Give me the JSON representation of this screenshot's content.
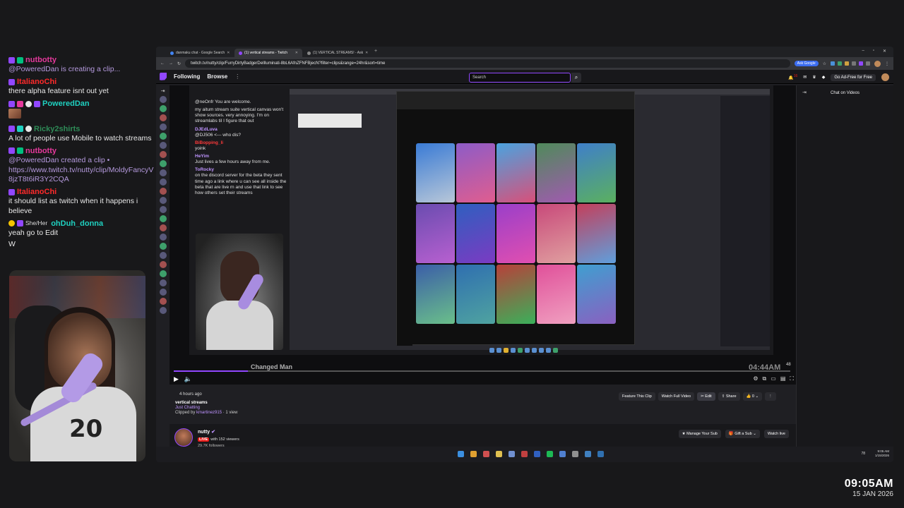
{
  "overlay_chat": [
    {
      "user": "nutbotty",
      "color": "#e5399c",
      "badges": [
        "b-purple",
        "b-green"
      ],
      "text": "@PoweredDan is creating a clip...",
      "text_color": "#b59ade"
    },
    {
      "user": "ItalianoChi",
      "color": "#ff2a2a",
      "badges": [
        "b-purple"
      ],
      "text": "there alpha feature isnt out yet",
      "text_color": "#e8e8e8"
    },
    {
      "user": "PoweredDan",
      "color": "#1fd0c0",
      "badges": [
        "b-purple",
        "b-pink",
        "b-white",
        "b-purple"
      ],
      "text": "",
      "text_color": "#e8e8e8",
      "emote": true
    },
    {
      "user": "Ricky2shirts",
      "color": "#2e8b57",
      "badges": [
        "b-purple",
        "b-teal",
        "b-white"
      ],
      "text": "A lot of people use Mobile to watch streams",
      "text_color": "#e8e8e8"
    },
    {
      "user": "nutbotty",
      "color": "#e5399c",
      "badges": [
        "b-purple",
        "b-green"
      ],
      "text": "@PoweredDan created a clip • https://www.twitch.tv/nutty/clip/MoldyFancyV8jzT8t6iR3Y2CQA",
      "text_color": "#b59ade"
    },
    {
      "user": "ItalianoChi",
      "color": "#ff2a2a",
      "badges": [
        "b-purple"
      ],
      "text": "it should list as twitch when it happens i believe",
      "text_color": "#e8e8e8"
    },
    {
      "user": "ohDuh_donna",
      "color": "#1fd0c0",
      "badges": [
        "b-yellow",
        "b-purple"
      ],
      "pronoun": "She/Her",
      "text": "yeah go to Edit",
      "text_color": "#e8e8e8"
    },
    {
      "user": "",
      "color": "#fff",
      "badges": [],
      "text": "W",
      "text_color": "#e8e8e8"
    }
  ],
  "clock": {
    "time": "09:05AM",
    "date": "15 JAN 2026"
  },
  "browser": {
    "tabs": [
      {
        "label": "danmaku chat - Google Search",
        "active": false
      },
      {
        "label": "(1) vertical streams - Twitch",
        "active": true
      },
      {
        "label": "(1) VERTICAL STREAMS! - Ask",
        "active": false
      }
    ],
    "new_tab": "+",
    "url": "twitch.tv/nutty/clip/FurryDirtyBadgerDeIlluminati-8bL6AfnZFNFBjecN?filter=clips&range=24hr&sort=time",
    "ask_label": "Ask Google",
    "window_controls": [
      "–",
      "▫",
      "✕"
    ]
  },
  "twitch": {
    "nav": {
      "following": "Following",
      "browse": "Browse",
      "more": "⋮"
    },
    "search_placeholder": "Search",
    "ad_free": "Go Ad-Free for Free",
    "notif_count": "16"
  },
  "player": {
    "song_title": "Changed Man",
    "overlay_time": "04:44AM",
    "view_corner": "48",
    "progress_fraction": 0.12
  },
  "embedded_chat": [
    {
      "u": "",
      "t": "@neOnfr You are welcome."
    },
    {
      "u": "",
      "t": "my aitum stream suite vertical canvas won't show sources. very annoying. I'm on streamlabs til I figure that out"
    },
    {
      "u": "DJEdLuva",
      "t": "@DJ506 <--- who dis?"
    },
    {
      "u": "BiBopping_li",
      "t": "yoink"
    },
    {
      "u": "HeYim",
      "t": "Just lives a few hours away from me."
    },
    {
      "u": "ToRocky",
      "t": "on the discord server for the beta they sent time ago a link where u can see all inside the beta that are live rn and use that link to see how others set their streams"
    }
  ],
  "clip": {
    "ago": "4 hours ago",
    "title": "vertical streams",
    "category": "Just Chatting",
    "clipped_by_prefix": "Clipped by",
    "clipped_by_user": "kmartinez915",
    "views": "· 1 view",
    "buttons": {
      "feature": "Feature This Clip",
      "watch_full": "Watch Full Video",
      "edit": "Edit",
      "share": "Share",
      "likes": "0"
    }
  },
  "channel": {
    "name": "nutty",
    "live_label": "LIVE",
    "viewers": "with 152 viewers",
    "followers": "29.7K followers",
    "manage_sub": "Manage Your Sub",
    "gift_sub": "Gift a Sub",
    "watch_live": "Watch live"
  },
  "chat_side": {
    "header": "Chat on Videos"
  },
  "taskbar": {
    "temp": "78",
    "time": "9:05 AM",
    "date": "1/15/2026"
  }
}
